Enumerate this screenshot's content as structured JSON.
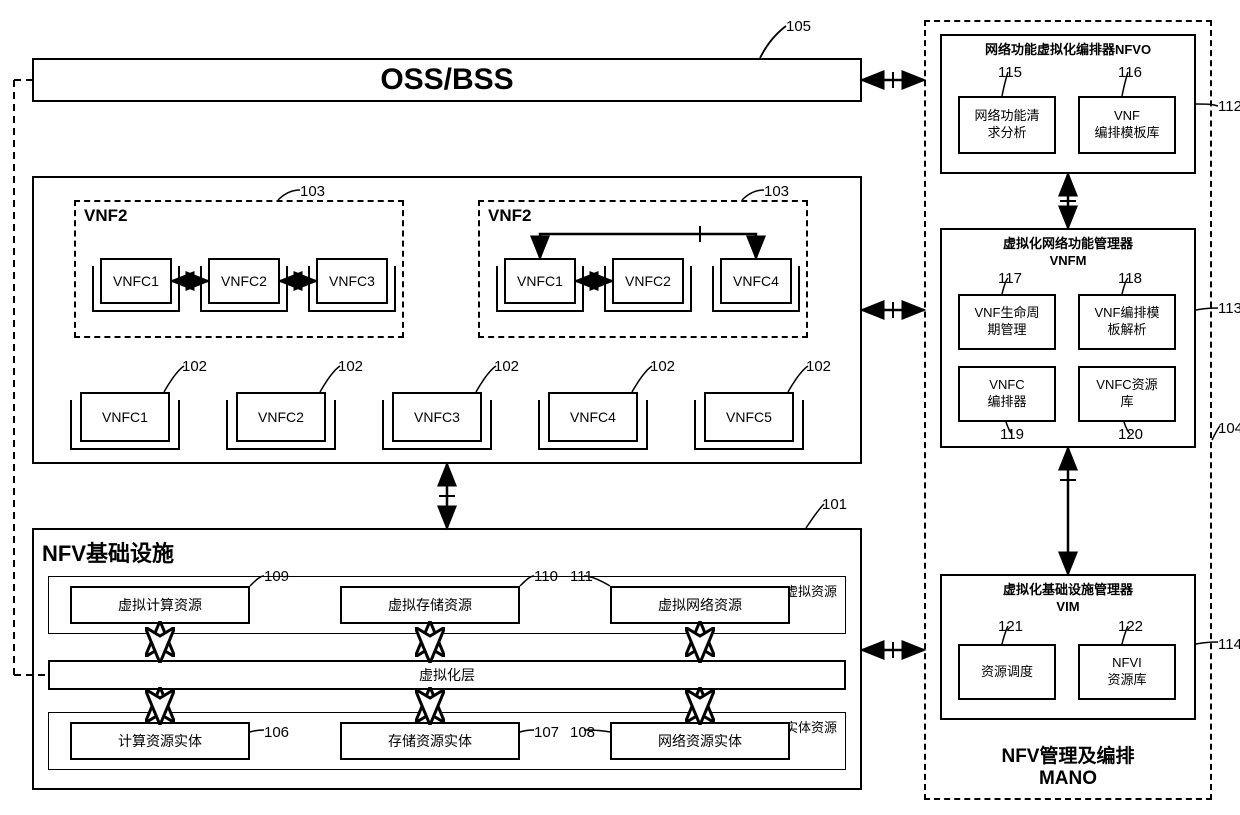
{
  "oss_bss": {
    "title": "OSS/BSS",
    "ref": "105"
  },
  "vnf_container": {
    "ref": "103"
  },
  "vnf_groups": [
    {
      "title": "VNF2",
      "components": [
        "VNFC1",
        "VNFC2",
        "VNFC3"
      ]
    },
    {
      "title": "VNF2",
      "components": [
        "VNFC1",
        "VNFC2",
        "VNFC4"
      ]
    }
  ],
  "vnfc_row": {
    "ref": "102",
    "items": [
      "VNFC1",
      "VNFC2",
      "VNFC3",
      "VNFC4",
      "VNFC5"
    ]
  },
  "nfvi": {
    "title": "NFV基础设施",
    "ref": "101",
    "virtual_label": "虚拟资源",
    "virtual": [
      {
        "name": "虚拟计算资源",
        "ref": "109"
      },
      {
        "name": "虚拟存储资源",
        "ref": "110"
      },
      {
        "name": "虚拟网络资源",
        "ref": "111"
      }
    ],
    "virt_layer": "虚拟化层",
    "physical_label": "实体资源",
    "physical": [
      {
        "name": "计算资源实体",
        "ref": "106"
      },
      {
        "name": "存储资源实体",
        "ref": "107"
      },
      {
        "name": "网络资源实体",
        "ref": "108"
      }
    ]
  },
  "mano": {
    "title": "NFV管理及编排\nMANO",
    "ref": "104",
    "nfvo": {
      "title": "网络功能虚拟化编排器NFVO",
      "ref": "112",
      "sub": [
        {
          "name": "网络功能清\n求分析",
          "ref": "115"
        },
        {
          "name": "VNF\n编排模板库",
          "ref": "116"
        }
      ]
    },
    "vnfm": {
      "title": "虚拟化网络功能管理器\nVNFM",
      "ref": "113",
      "sub": [
        {
          "name": "VNF生命周\n期管理",
          "ref": "117"
        },
        {
          "name": "VNF编排模\n板解析",
          "ref": "118"
        },
        {
          "name": "VNFC\n编排器",
          "ref": "119"
        },
        {
          "name": "VNFC资源\n库",
          "ref": "120"
        }
      ]
    },
    "vim": {
      "title": "虚拟化基础设施管理器\nVIM",
      "ref": "114",
      "sub": [
        {
          "name": "资源调度",
          "ref": "121"
        },
        {
          "name": "NFVI\n资源库",
          "ref": "122"
        }
      ]
    }
  }
}
